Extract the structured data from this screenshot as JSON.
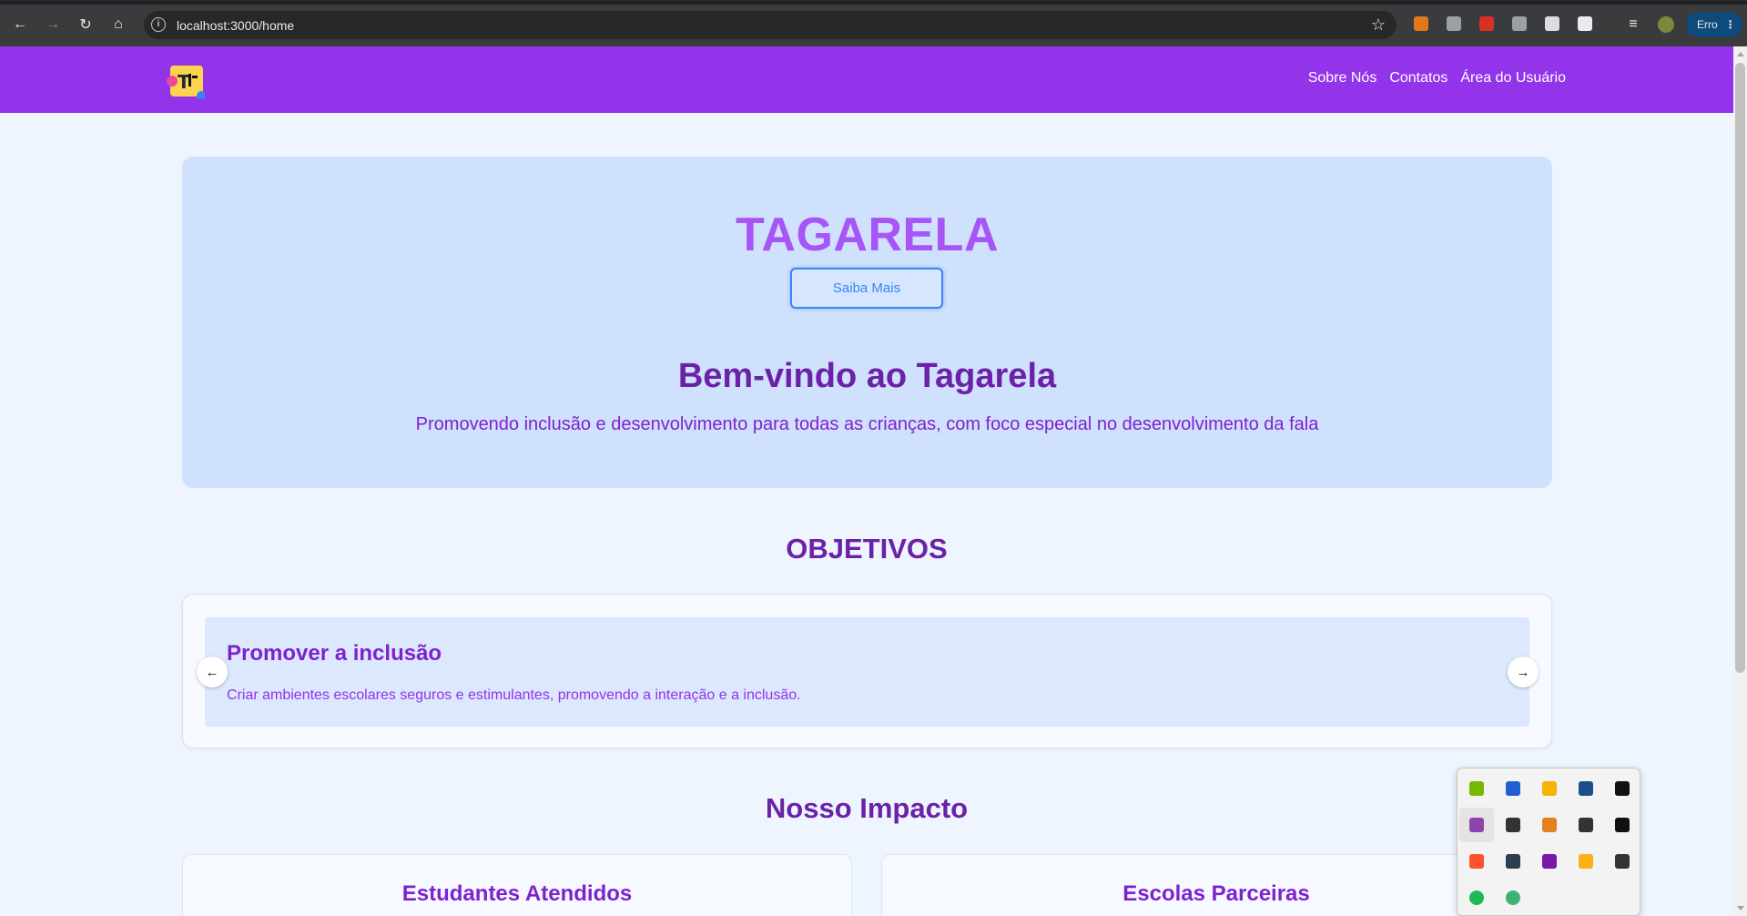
{
  "browser": {
    "url": "localhost:3000/home",
    "profile_label": "Erro",
    "extensions": [
      {
        "name": "metamask-icon",
        "color": "#e2761b"
      },
      {
        "name": "extension-gray-icon",
        "color": "#9aa0a6"
      },
      {
        "name": "extension-red-icon",
        "color": "#d93025"
      },
      {
        "name": "extension-aw-icon",
        "color": "#9aa0a6"
      },
      {
        "name": "extension-doc-icon",
        "color": "#dadce0"
      },
      {
        "name": "puzzle-extensions-icon",
        "color": "#e8eaed"
      }
    ]
  },
  "header": {
    "nav": [
      "Sobre Nós",
      "Contatos",
      "Área do Usuário"
    ]
  },
  "hero": {
    "title": "TAGARELA",
    "button": "Saiba Mais",
    "heading": "Bem-vindo ao Tagarela",
    "subtitle": "Promovendo inclusão e desenvolvimento para todas as crianças, com foco especial no desenvolvimento da fala"
  },
  "objetivos": {
    "title": "OBJETIVOS",
    "slide_title": "Promover a inclusão",
    "slide_text": "Criar ambientes escolares seguros e estimulantes, promovendo a interação e a inclusão.",
    "prev": "←",
    "next": "→"
  },
  "impacto": {
    "title": "Nosso Impacto",
    "cards": [
      "Estudantes Atendidos",
      "Escolas Parceiras"
    ]
  },
  "tray": {
    "icons": [
      {
        "name": "nvidia-icon",
        "color": "#76b900"
      },
      {
        "name": "malwarebytes-icon",
        "color": "#1f5fd6"
      },
      {
        "name": "security-shield-icon",
        "color": "#f4b400"
      },
      {
        "name": "steam-icon",
        "color": "#1b4f8a"
      },
      {
        "name": "g-hub-icon",
        "color": "#111111"
      },
      {
        "name": "pen-icon",
        "color": "#8e44ad"
      },
      {
        "name": "webcam-icon",
        "color": "#333333"
      },
      {
        "name": "orange-app-icon",
        "color": "#e67e22"
      },
      {
        "name": "diamond-app-icon",
        "color": "#333333"
      },
      {
        "name": "epic-games-icon",
        "color": "#111111"
      },
      {
        "name": "brave-icon",
        "color": "#fb542b"
      },
      {
        "name": "cloud-sync-icon",
        "color": "#2c3e50"
      },
      {
        "name": "onenote-icon",
        "color": "#7719aa"
      },
      {
        "name": "rockstar-icon",
        "color": "#fcaf17"
      },
      {
        "name": "display-icon",
        "color": "#333333"
      },
      {
        "name": "spotify-icon",
        "color": "#1db954"
      },
      {
        "name": "green-status-icon",
        "color": "#3cb371"
      }
    ]
  }
}
